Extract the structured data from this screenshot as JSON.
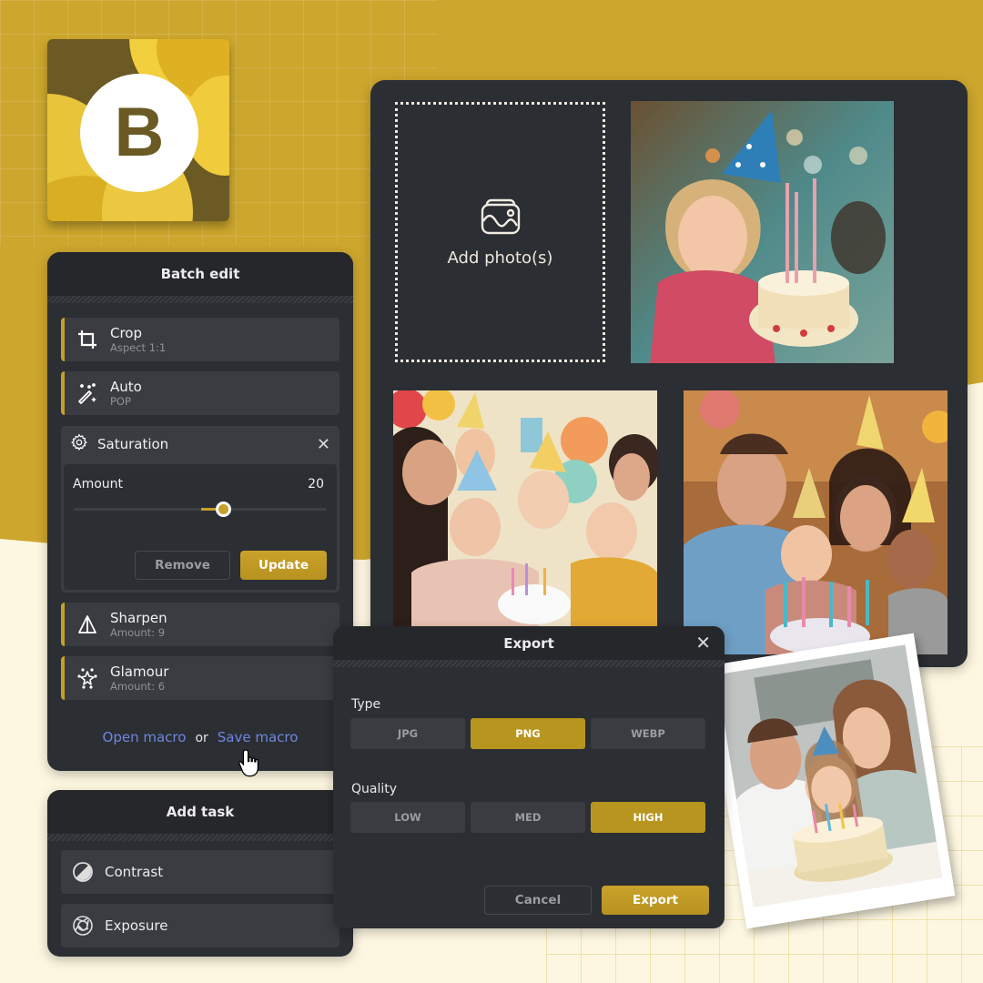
{
  "brand": {
    "logo_letter": "B",
    "accent": "#c5a02a",
    "background_gold": "#cca62d",
    "background_cream": "#fdf7e1",
    "panel": "#2b2e33",
    "link": "#6f86e0"
  },
  "batch_edit": {
    "title": "Batch edit",
    "tasks": [
      {
        "name": "Crop",
        "detail": "Aspect 1:1",
        "icon": "crop-icon"
      },
      {
        "name": "Auto",
        "detail": "POP",
        "icon": "magic-wand-icon"
      }
    ],
    "saturation": {
      "title": "Saturation",
      "icon": "gear-icon",
      "amount_label": "Amount",
      "amount_value": "20",
      "slider_fraction": 0.59,
      "remove_label": "Remove",
      "update_label": "Update"
    },
    "tasks_after": [
      {
        "name": "Sharpen",
        "detail": "Amount: 9",
        "icon": "sharpen-triangle-icon"
      },
      {
        "name": "Glamour",
        "detail": "Amount: 6",
        "icon": "sparkle-star-icon"
      }
    ],
    "open_macro": "Open macro",
    "or": "or",
    "save_macro": "Save macro"
  },
  "add_task": {
    "title": "Add task",
    "items": [
      {
        "name": "Contrast",
        "icon": "contrast-icon"
      },
      {
        "name": "Exposure",
        "icon": "aperture-icon"
      }
    ]
  },
  "photo_grid": {
    "add_photo_label": "Add photo(s)",
    "photos": [
      {
        "alt": "Girl in party hat with birthday cake"
      },
      {
        "alt": "Family celebrating with children in party hats"
      },
      {
        "alt": "Family with kids and birthday candles"
      }
    ]
  },
  "export_dialog": {
    "title": "Export",
    "type_label": "Type",
    "types": [
      "JPG",
      "PNG",
      "WEBP"
    ],
    "selected_type": "PNG",
    "quality_label": "Quality",
    "qualities": [
      "LOW",
      "MED",
      "HIGH"
    ],
    "selected_quality": "HIGH",
    "cancel_label": "Cancel",
    "export_label": "Export"
  },
  "polaroid": {
    "alt": "Family portrait with birthday cake"
  }
}
